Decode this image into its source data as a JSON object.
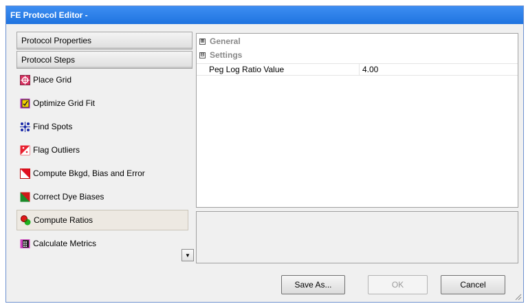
{
  "window": {
    "title": "FE Protocol Editor -"
  },
  "left_panel": {
    "header_buttons": [
      "Protocol Properties",
      "Protocol Steps"
    ],
    "steps": [
      {
        "label": "Place Grid",
        "icon": "place-grid-icon"
      },
      {
        "label": "Optimize Grid Fit",
        "icon": "optimize-grid-icon"
      },
      {
        "label": "Find Spots",
        "icon": "find-spots-icon"
      },
      {
        "label": "Flag Outliers",
        "icon": "flag-outliers-icon"
      },
      {
        "label": "Compute Bkgd, Bias and Error",
        "icon": "compute-bkgd-icon"
      },
      {
        "label": "Correct Dye Biases",
        "icon": "correct-dye-icon"
      },
      {
        "label": "Compute Ratios",
        "icon": "compute-ratios-icon",
        "selected": true
      },
      {
        "label": "Calculate Metrics",
        "icon": "calculate-metrics-icon"
      }
    ]
  },
  "property_grid": {
    "categories": [
      {
        "expander": "⊞",
        "label": "General"
      },
      {
        "expander": "⊟",
        "label": "Settings"
      }
    ],
    "properties": [
      {
        "name": "Peg Log Ratio Value",
        "value": "4.00"
      }
    ]
  },
  "buttons": {
    "save_as": "Save As...",
    "ok": "OK",
    "cancel": "Cancel"
  },
  "colors": {
    "title_bar": "#1f73df",
    "window_bg": "#f0f0f0",
    "selected_step": "#ede9e2"
  }
}
